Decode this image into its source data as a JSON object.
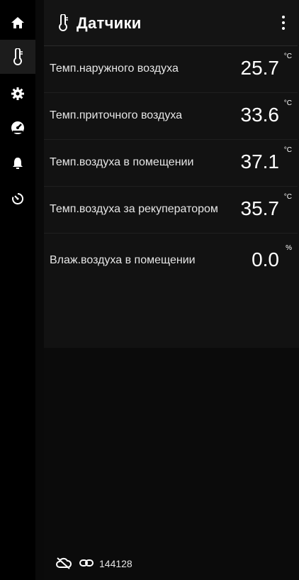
{
  "header": {
    "title": "Датчики",
    "icon": "thermometer-icon",
    "menu_icon": "more-vertical-icon"
  },
  "sidebar": {
    "items": [
      {
        "name": "home",
        "icon": "home-icon",
        "active": false
      },
      {
        "name": "sensors",
        "icon": "thermometer-icon",
        "active": true
      },
      {
        "name": "settings",
        "icon": "gear-icon",
        "active": false
      },
      {
        "name": "gauge",
        "icon": "speedometer-icon",
        "active": false
      },
      {
        "name": "alarms",
        "icon": "bell-icon",
        "active": false
      },
      {
        "name": "timer",
        "icon": "timer-icon",
        "active": false
      }
    ]
  },
  "sensors": [
    {
      "label": "Темп.наружного воздуха",
      "value": "25.7",
      "unit": "°C"
    },
    {
      "label": "Темп.приточного воздуха",
      "value": "33.6",
      "unit": "°C"
    },
    {
      "label": "Темп.воздуха в помещении",
      "value": "37.1",
      "unit": "°C"
    },
    {
      "label": "Темп.воздуха за рекуператором",
      "value": "35.7",
      "unit": "°C"
    },
    {
      "label": "Влаж.воздуха в помещении",
      "value": "0.0",
      "unit": "%"
    }
  ],
  "footer": {
    "cloud_icon": "cloud-off-icon",
    "link_icon": "link-icon",
    "device_id": "144128"
  },
  "colors": {
    "background": "#000000",
    "panel": "#121212",
    "text": "#ffffff",
    "active_sidebar": "#1c1c1c"
  }
}
